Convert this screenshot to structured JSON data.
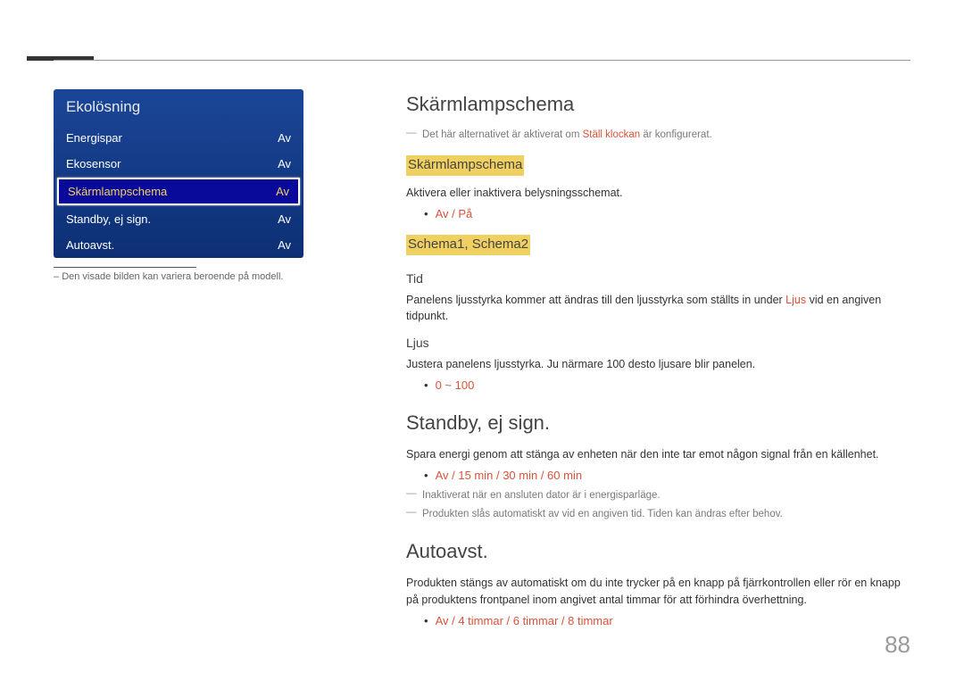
{
  "menu": {
    "title": "Ekolösning",
    "items": [
      {
        "label": "Energispar",
        "value": "Av",
        "selected": false
      },
      {
        "label": "Ekosensor",
        "value": "Av",
        "selected": false
      },
      {
        "label": "Skärmlampschema",
        "value": "Av",
        "selected": true
      },
      {
        "label": "Standby, ej sign.",
        "value": "Av",
        "selected": false
      },
      {
        "label": "Autoavst.",
        "value": "Av",
        "selected": false
      }
    ],
    "footnote": "Den visade bilden kan variera beroende på modell."
  },
  "sections": {
    "skarmlamp": {
      "heading": "Skärmlampschema",
      "note1_pre": "Det här alternativet är aktiverat om ",
      "note1_red": "Ställ klockan",
      "note1_post": " är konfigurerat.",
      "sub1": "Skärmlampschema",
      "sub1_desc": "Aktivera eller inaktivera belysningsschemat.",
      "sub1_opts": "Av / På",
      "sub2": "Schema1, Schema2",
      "tid_label": "Tid",
      "tid_desc_pre": "Panelens ljusstyrka kommer att ändras till den ljusstyrka som ställts in under ",
      "tid_desc_red": "Ljus",
      "tid_desc_post": " vid en angiven tidpunkt.",
      "ljus_label": "Ljus",
      "ljus_desc": "Justera panelens ljusstyrka. Ju närmare 100 desto ljusare blir panelen.",
      "ljus_range": "0 ~ 100"
    },
    "standby": {
      "heading": "Standby, ej sign.",
      "desc": "Spara energi genom att stänga av enheten när den inte tar emot någon signal från en källenhet.",
      "opts": "Av / 15 min / 30 min / 60 min",
      "note1": "Inaktiverat när en ansluten dator är i energisparläge.",
      "note2": "Produkten slås automatiskt av vid en angiven tid. Tiden kan ändras efter behov."
    },
    "autoavst": {
      "heading": "Autoavst.",
      "desc": "Produkten stängs av automatiskt om du inte trycker på en knapp på fjärrkontrollen eller rör en knapp på produktens frontpanel inom angivet antal timmar för att förhindra överhettning.",
      "opts": "Av / 4 timmar / 6 timmar / 8 timmar"
    }
  },
  "page": "88"
}
